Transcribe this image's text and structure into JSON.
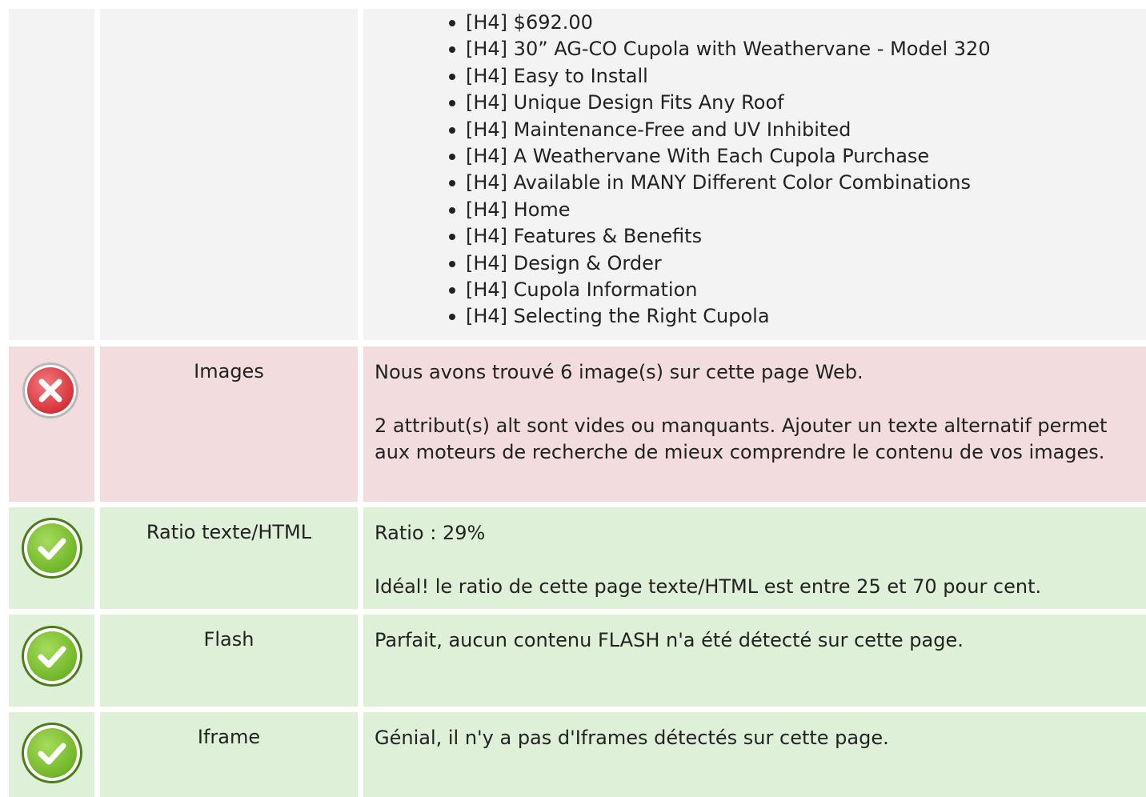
{
  "headings": {
    "items": [
      "[H4] $692.00",
      "[H4] 30” AG-CO Cupola with Weathervane - Model 320",
      "[H4] Easy to Install",
      "[H4] Unique Design Fits Any Roof",
      "[H4] Maintenance-Free and UV Inhibited",
      "[H4] A Weathervane With Each Cupola Purchase",
      "[H4] Available in MANY Different Color Combinations",
      "[H4] Home",
      "[H4] Features & Benefits",
      "[H4] Design & Order",
      "[H4] Cupola Information",
      "[H4] Selecting the Right Cupola"
    ]
  },
  "checks": [
    {
      "status": "error",
      "icon": "error-x-icon",
      "label": "Images",
      "lines": [
        "Nous avons trouvé 6 image(s) sur cette page Web.",
        "2 attribut(s) alt sont vides ou manquants. Ajouter un texte alternatif permet aux moteurs de recherche de mieux comprendre le contenu de vos images."
      ]
    },
    {
      "status": "ok",
      "icon": "check-icon",
      "label": "Ratio texte/HTML",
      "lines": [
        "Ratio : 29%",
        "Idéal! le ratio de cette page texte/HTML est entre 25 et 70 pour cent."
      ]
    },
    {
      "status": "ok",
      "icon": "check-icon",
      "label": "Flash",
      "lines": [
        "Parfait, aucun contenu FLASH n'a été détecté sur cette page."
      ]
    },
    {
      "status": "ok",
      "icon": "check-icon",
      "label": "Iframe",
      "lines": [
        "Génial, il n'y a pas d'Iframes détectés sur cette page."
      ]
    }
  ],
  "colors": {
    "error_bg": "#f2dcde",
    "ok_bg": "#dff0d8",
    "neutral_bg": "#f3f3f3",
    "error_icon": "#e0393e",
    "ok_icon": "#7cc42a"
  }
}
